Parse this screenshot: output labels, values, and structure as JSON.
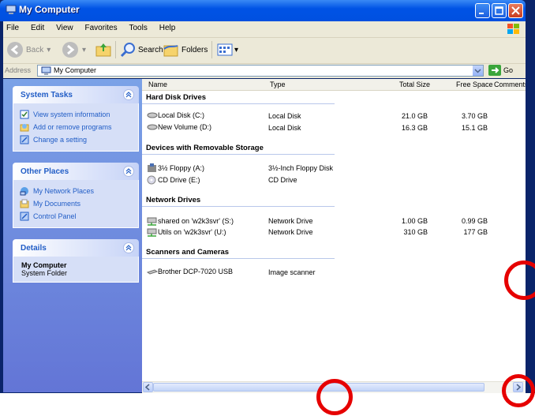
{
  "window": {
    "title": "My Computer",
    "minimize_icon": "minimize-icon",
    "maximize_icon": "maximize-icon",
    "close_icon": "close-icon"
  },
  "menu": [
    "File",
    "Edit",
    "View",
    "Favorites",
    "Tools",
    "Help"
  ],
  "toolbar": {
    "back_label": "Back",
    "search_label": "Search",
    "folders_label": "Folders"
  },
  "address": {
    "label": "Address",
    "value": "My Computer",
    "go_label": "Go"
  },
  "left_pane": {
    "system_tasks": {
      "title": "System Tasks",
      "items": [
        "View system information",
        "Add or remove programs",
        "Change a setting"
      ]
    },
    "other_places": {
      "title": "Other Places",
      "items": [
        "My Network Places",
        "My Documents",
        "Control Panel"
      ]
    },
    "details": {
      "title": "Details",
      "name": "My Computer",
      "type": "System Folder"
    }
  },
  "columns": [
    "Name",
    "Type",
    "Total Size",
    "Free Space",
    "Comments"
  ],
  "groups": [
    {
      "title": "Hard Disk Drives",
      "items": [
        {
          "name": "Local Disk (C:)",
          "type": "Local Disk",
          "total": "21.0 GB",
          "free": "3.70 GB"
        },
        {
          "name": "New Volume (D:)",
          "type": "Local Disk",
          "total": "16.3 GB",
          "free": "15.1 GB"
        }
      ]
    },
    {
      "title": "Devices with Removable Storage",
      "items": [
        {
          "name": "3½ Floppy (A:)",
          "type": "3½-Inch Floppy Disk",
          "total": "",
          "free": ""
        },
        {
          "name": "CD Drive (E:)",
          "type": "CD Drive",
          "total": "",
          "free": ""
        }
      ]
    },
    {
      "title": "Network Drives",
      "items": [
        {
          "name": "shared on 'w2k3svr' (S:)",
          "type": "Network Drive",
          "total": "1.00 GB",
          "free": "0.99 GB"
        },
        {
          "name": "Utils on 'w2k3svr' (U:)",
          "type": "Network Drive",
          "total": "310 GB",
          "free": "177 GB"
        }
      ]
    },
    {
      "title": "Scanners and Cameras",
      "items": [
        {
          "name": "Brother DCP-7020 USB",
          "type": "Image scanner",
          "total": "",
          "free": ""
        }
      ]
    }
  ],
  "colors": {
    "titlebar": "#0053e5",
    "task_pane": "#6f8fe0",
    "link": "#215dc6",
    "annotation": "#e60000"
  }
}
